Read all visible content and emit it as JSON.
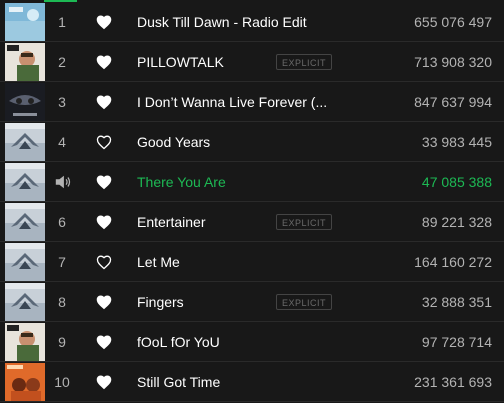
{
  "colors": {
    "background": "#181818",
    "text": "#ffffff",
    "muted": "#b3b3b3",
    "accent": "#1db954"
  },
  "tracks": [
    {
      "index": "1",
      "title": "Dusk Till Dawn - Radio Edit",
      "explicit": false,
      "liked": true,
      "plays": "655 076 497",
      "playing": false,
      "cover": "cover-blue-sky"
    },
    {
      "index": "2",
      "title": "PILLOWTALK",
      "explicit": true,
      "explicit_label": "EXPLICIT",
      "liked": true,
      "plays": "713 908 320",
      "playing": false,
      "cover": "cover-mind-of-mine"
    },
    {
      "index": "3",
      "title": "I Don’t Wanna Live Forever (...",
      "explicit": false,
      "liked": true,
      "plays": "847 637 994",
      "playing": false,
      "cover": "cover-fifty-shades"
    },
    {
      "index": "4",
      "title": "Good Years",
      "explicit": false,
      "liked": false,
      "plays": "33 983 445",
      "playing": false,
      "cover": "cover-icarus"
    },
    {
      "index": "",
      "title": "There You Are",
      "explicit": false,
      "liked": true,
      "plays": "47 085 388",
      "playing": true,
      "cover": "cover-icarus"
    },
    {
      "index": "6",
      "title": "Entertainer",
      "explicit": true,
      "explicit_label": "EXPLICIT",
      "liked": true,
      "plays": "89 221 328",
      "playing": false,
      "cover": "cover-icarus"
    },
    {
      "index": "7",
      "title": "Let Me",
      "explicit": false,
      "liked": false,
      "plays": "164 160 272",
      "playing": false,
      "cover": "cover-icarus"
    },
    {
      "index": "8",
      "title": "Fingers",
      "explicit": true,
      "explicit_label": "EXPLICIT",
      "liked": true,
      "plays": "32 888 351",
      "playing": false,
      "cover": "cover-icarus"
    },
    {
      "index": "9",
      "title": "fOoL fOr YoU",
      "explicit": false,
      "liked": true,
      "plays": "97 728 714",
      "playing": false,
      "cover": "cover-mind-of-mine"
    },
    {
      "index": "10",
      "title": "Still Got Time",
      "explicit": false,
      "liked": true,
      "plays": "231 361 693",
      "playing": false,
      "cover": "cover-orange"
    }
  ]
}
